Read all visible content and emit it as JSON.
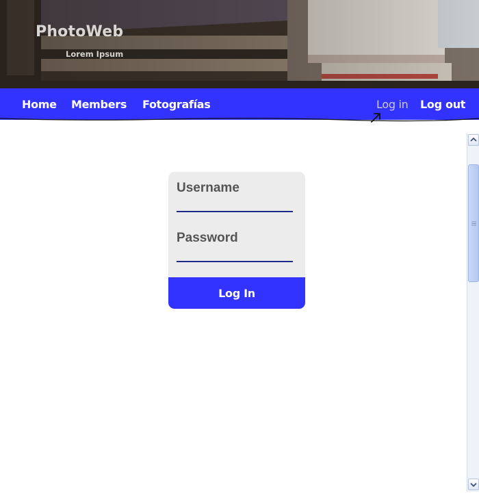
{
  "header": {
    "site_title": "PhotoWeb",
    "site_subtitle": "Lorem Ipsum"
  },
  "nav": {
    "items": [
      {
        "label": "Home"
      },
      {
        "label": "Members"
      },
      {
        "label": "Fotografías"
      }
    ],
    "login_label": "Log in",
    "logout_label": "Log out"
  },
  "login_form": {
    "username_label": "Username",
    "username_value": "",
    "password_label": "Password",
    "password_value": "",
    "submit_label": "Log In"
  },
  "colors": {
    "nav_background": "#3333ff",
    "card_background": "#ececec",
    "input_underline": "#1e2a8a",
    "login_dim_text": "#c9c9f2"
  },
  "icons": {
    "cursor": "arrow-up-right-icon",
    "scroll_up": "chevron-up-icon",
    "scroll_down": "chevron-down-icon",
    "scroll_grip": "grip-lines-icon"
  }
}
